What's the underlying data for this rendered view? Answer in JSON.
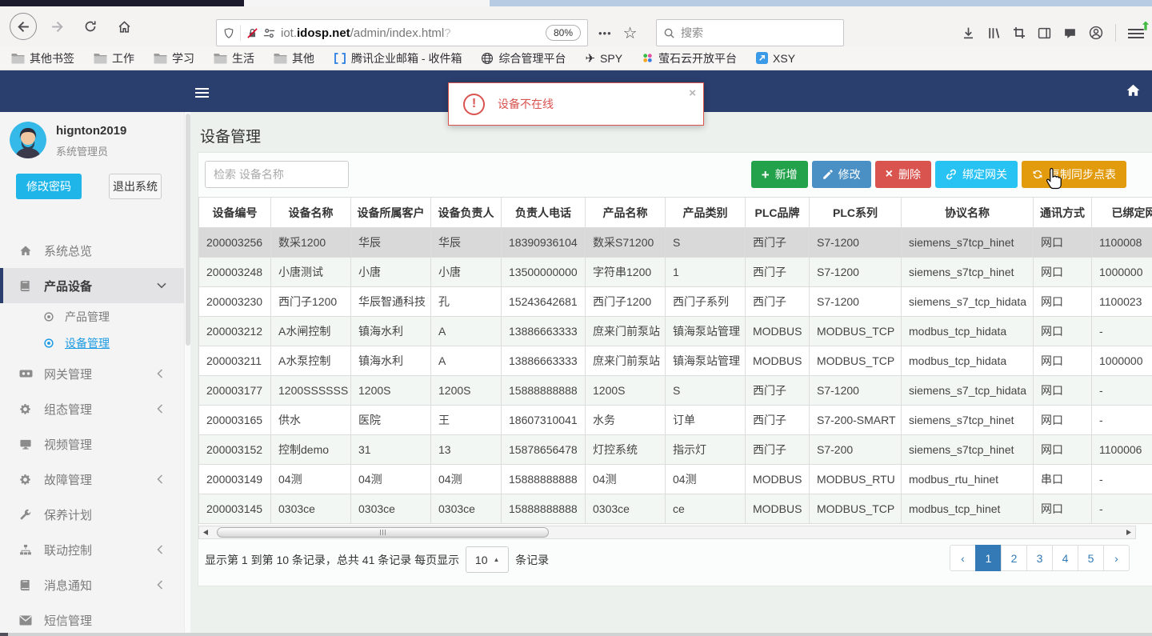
{
  "browser": {
    "url": {
      "prefix": "iot.",
      "domain": "idosp.net",
      "path": "/admin/index.html",
      "faded": "?"
    },
    "zoom_badge": "80%",
    "search_placeholder": "搜索",
    "bookmark_folders": [
      {
        "key": "other-bookmarks",
        "label": "其他书签"
      },
      {
        "key": "work",
        "label": "工作"
      },
      {
        "key": "study",
        "label": "学习"
      },
      {
        "key": "life",
        "label": "生活"
      },
      {
        "key": "misc",
        "label": "其他"
      }
    ],
    "bookmark_links": [
      {
        "key": "tencent-mail",
        "icon": "mail-icon",
        "label": "腾讯企业邮箱 - 收件箱"
      },
      {
        "key": "mgmt-platform",
        "icon": "globe-icon",
        "label": "综合管理平台"
      },
      {
        "key": "spy",
        "icon": "plane-icon",
        "label": "SPY"
      },
      {
        "key": "ys-cloud",
        "icon": "dots4-icon",
        "label": "萤石云开放平台"
      },
      {
        "key": "xsy",
        "icon": "xsy-icon",
        "label": "XSY"
      }
    ]
  },
  "alert": {
    "message": "设备不在线"
  },
  "sidebar": {
    "username": "hignton2019",
    "role": "系统管理员",
    "change_password": "修改密码",
    "logout": "退出系统",
    "menu": [
      {
        "key": "overview",
        "icon": "home-solid-icon",
        "label": "系统总览"
      },
      {
        "key": "product-device",
        "icon": "book-icon",
        "label": "产品设备",
        "chevron": "down",
        "active": true,
        "children": [
          {
            "key": "product-manage",
            "icon": "dot-circle-icon",
            "label": "产品管理"
          },
          {
            "key": "device-manage",
            "icon": "dot-circle-icon",
            "label": "设备管理",
            "active": true
          }
        ]
      },
      {
        "key": "gateway",
        "icon": "gateway-icon",
        "label": "网关管理",
        "chevron": "left"
      },
      {
        "key": "scada",
        "icon": "gear-icon",
        "label": "组态管理",
        "chevron": "left"
      },
      {
        "key": "video",
        "icon": "monitor-icon",
        "label": "视频管理"
      },
      {
        "key": "fault",
        "icon": "gear-icon",
        "label": "故障管理",
        "chevron": "left"
      },
      {
        "key": "maintenance",
        "icon": "wrench-icon",
        "label": "保养计划"
      },
      {
        "key": "linkage",
        "icon": "sitemap-icon",
        "label": "联动控制",
        "chevron": "left"
      },
      {
        "key": "message",
        "icon": "book-icon",
        "label": "消息通知",
        "chevron": "left"
      },
      {
        "key": "sms",
        "icon": "envelope-icon",
        "label": "短信管理"
      }
    ]
  },
  "main": {
    "title": "设备管理",
    "search_placeholder": "检索 设备名称",
    "toolbar": [
      {
        "key": "add",
        "icon": "plus-icon",
        "label": "新增",
        "color": "#23a24b"
      },
      {
        "key": "edit",
        "icon": "pencil-icon",
        "label": "修改",
        "color": "#4a90c4"
      },
      {
        "key": "delete",
        "icon": "x-icon",
        "label": "删除",
        "color": "#d9534f"
      },
      {
        "key": "bind-gateway",
        "icon": "link-icon",
        "label": "绑定网关",
        "color": "#29c3f3"
      },
      {
        "key": "copy-sync",
        "icon": "sync-icon",
        "label": "复制同步点表",
        "color": "#e29b0d"
      }
    ],
    "table": {
      "headers": [
        "设备编号",
        "设备名称",
        "设备所属客户",
        "设备负责人",
        "负责人电话",
        "产品名称",
        "产品类别",
        "PLC品牌",
        "PLC系列",
        "协议名称",
        "通讯方式",
        "已绑定网关"
      ],
      "selected_row": 0,
      "rows": [
        [
          "200003256",
          "数采1200",
          "华辰",
          "华辰",
          "18390936104",
          "数采S71200",
          "S",
          "西门子",
          "S7-1200",
          "siemens_s7tcp_hinet",
          "网口",
          "1100008"
        ],
        [
          "200003248",
          "小唐测试",
          "小唐",
          "小唐",
          "13500000000",
          "字符串1200",
          "1",
          "西门子",
          "S7-1200",
          "siemens_s7tcp_hinet",
          "网口",
          "1000000"
        ],
        [
          "200003230",
          "西门子1200",
          "华辰智通科技",
          "孔",
          "15243642681",
          "西门子1200",
          "西门子系列",
          "西门子",
          "S7-1200",
          "siemens_s7_tcp_hidata",
          "网口",
          "1100023"
        ],
        [
          "200003212",
          "A水闸控制",
          "镇海水利",
          "A",
          "13886663333",
          "庶来门前泵站",
          "镇海泵站管理",
          "MODBUS",
          "MODBUS_TCP",
          "modbus_tcp_hidata",
          "网口",
          "-"
        ],
        [
          "200003211",
          "A水泵控制",
          "镇海水利",
          "A",
          "13886663333",
          "庶来门前泵站",
          "镇海泵站管理",
          "MODBUS",
          "MODBUS_TCP",
          "modbus_tcp_hidata",
          "网口",
          "1000000"
        ],
        [
          "200003177",
          "1200SSSSSS",
          "1200S",
          "1200S",
          "15888888888",
          "1200S",
          "S",
          "西门子",
          "S7-1200",
          "siemens_s7_tcp_hidata",
          "网口",
          "-"
        ],
        [
          "200003165",
          "供水",
          "医院",
          "王",
          "18607310041",
          "水务",
          "订单",
          "西门子",
          "S7-200-SMART",
          "siemens_s7tcp_hinet",
          "网口",
          "-"
        ],
        [
          "200003152",
          "控制demo",
          "31",
          "13",
          "15878656478",
          "灯控系统",
          "指示灯",
          "西门子",
          "S7-200",
          "siemens_s7tcp_hinet",
          "网口",
          "1100006"
        ],
        [
          "200003149",
          "04测",
          "04测",
          "04测",
          "15888888888",
          "04测",
          "04测",
          "MODBUS",
          "MODBUS_RTU",
          "modbus_rtu_hinet",
          "串口",
          "-"
        ],
        [
          "200003145",
          "0303ce",
          "0303ce",
          "0303ce",
          "15888888888",
          "0303ce",
          "ce",
          "MODBUS",
          "MODBUS_TCP",
          "modbus_tcp_hinet",
          "网口",
          "-"
        ]
      ]
    },
    "footer": {
      "summary_prefix": "显示第 1 到第 10 条记录，总共 41 条记录 每页显示",
      "page_size": "10",
      "summary_suffix": "条记录",
      "prev": "‹",
      "next": "›",
      "pages": [
        "1",
        "2",
        "3",
        "4",
        "5"
      ],
      "active_page": "1"
    }
  },
  "colors": {
    "navbar": "#2a3f6e",
    "alert_red": "#d9534f",
    "link_blue": "#1d9be2",
    "pagination_blue": "#337ab7",
    "change_password_cyan": "#1fb5e9"
  }
}
